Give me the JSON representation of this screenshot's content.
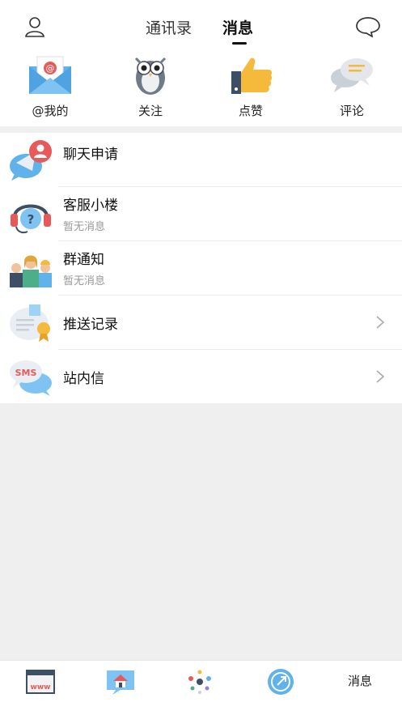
{
  "header": {
    "tabs": [
      {
        "label": "通讯录",
        "active": false
      },
      {
        "label": "消息",
        "active": true
      }
    ],
    "left_icon": "profile-icon",
    "right_icon": "chat-bubble-icon"
  },
  "quick_actions": [
    {
      "label": "@我的",
      "icon": "mail-at-icon"
    },
    {
      "label": "关注",
      "icon": "owl-icon"
    },
    {
      "label": "点赞",
      "icon": "thumbs-up-icon"
    },
    {
      "label": "评论",
      "icon": "comment-icon"
    }
  ],
  "messages": [
    {
      "title": "聊天申请",
      "subtitle": "",
      "icon": "chat-request-icon",
      "chevron": false
    },
    {
      "title": "客服小楼",
      "subtitle": "暂无消息",
      "icon": "support-headset-icon",
      "chevron": false
    },
    {
      "title": "群通知",
      "subtitle": "暂无消息",
      "icon": "group-icon",
      "chevron": false
    },
    {
      "title": "推送记录",
      "subtitle": "",
      "icon": "certificate-icon",
      "chevron": true
    },
    {
      "title": "站内信",
      "subtitle": "",
      "icon": "sms-icon",
      "chevron": true
    }
  ],
  "bottom_nav": {
    "items": [
      {
        "icon": "www-icon"
      },
      {
        "icon": "home-icon"
      },
      {
        "icon": "dots-icon"
      },
      {
        "icon": "compass-icon"
      }
    ],
    "active_label": "消息"
  },
  "colors": {
    "background": "#efefef",
    "thumbs_up": "#f5b93c",
    "mail_blue": "#4fa3e0",
    "sms_red": "#e85a5a"
  }
}
